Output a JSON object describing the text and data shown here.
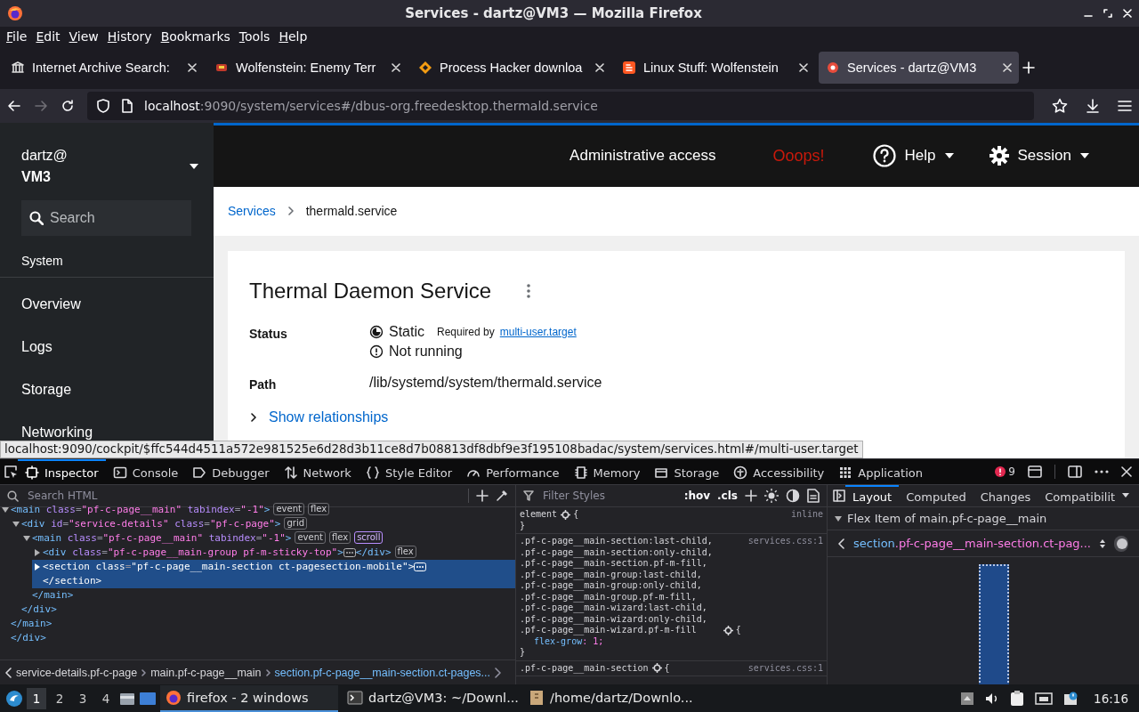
{
  "window": {
    "title": "Services - dartz@VM3 — Mozilla Firefox"
  },
  "menu_bar": [
    "File",
    "Edit",
    "View",
    "History",
    "Bookmarks",
    "Tools",
    "Help"
  ],
  "tabs": [
    {
      "label": "Internet Archive Search:",
      "kind": "archive",
      "selected": false
    },
    {
      "label": "Wolfenstein: Enemy Terr",
      "kind": "game",
      "selected": false
    },
    {
      "label": "Process Hacker downloa",
      "kind": "diamond",
      "selected": false
    },
    {
      "label": "Linux Stuff: Wolfenstein",
      "kind": "blog",
      "selected": false
    },
    {
      "label": "Services - dartz@VM3",
      "kind": "cockpit",
      "selected": true
    }
  ],
  "address_bar": {
    "host": "localhost",
    "rest": ":9090/system/services#/dbus-org.freedesktop.thermald.service"
  },
  "cockpit": {
    "sidebar": {
      "user": "dartz@",
      "host": "VM3",
      "search": {
        "placeholder": "Search"
      },
      "section": "System",
      "items": [
        {
          "label": "Overview",
          "selected": false
        },
        {
          "label": "Logs",
          "selected": false
        },
        {
          "label": "Storage",
          "selected": false
        },
        {
          "label": "Networking",
          "selected": false
        }
      ]
    },
    "header": {
      "admin": "Administrative access",
      "alert": "Ooops!",
      "help": "Help",
      "session": "Session"
    },
    "breadcrumb": [
      {
        "label": "Services",
        "kind": "link"
      },
      {
        "label": "thermald.service",
        "kind": "current"
      }
    ],
    "service": {
      "title": "Thermal Daemon Service",
      "fields": [
        {
          "label": "Status",
          "values": [
            {
              "kind": "static",
              "text": "Static",
              "note": "Required by",
              "link": "multi-user.target"
            },
            {
              "kind": "stopped",
              "text": "Not running"
            }
          ]
        },
        {
          "label": "Path",
          "values": [
            {
              "kind": "plain",
              "text": "/lib/systemd/system/thermald.service"
            }
          ]
        }
      ],
      "relationships": {
        "label": "Show relationships",
        "expanded": false
      }
    }
  },
  "status_tooltip": "localhost:9090/cockpit/$ffc544d4511a572e981525e6d28d3b11ce8d7b08813df8dbf9e3f195108badac/system/services.html#/multi-user.target",
  "devtools": {
    "tabs": [
      {
        "label": "Inspector",
        "kind": "inspector",
        "selected": true
      },
      {
        "label": "Console",
        "kind": "console",
        "selected": false
      },
      {
        "label": "Debugger",
        "kind": "debugger",
        "selected": false
      },
      {
        "label": "Network",
        "kind": "network",
        "selected": false
      },
      {
        "label": "Style Editor",
        "kind": "style",
        "selected": false
      },
      {
        "label": "Performance",
        "kind": "performance",
        "selected": false
      },
      {
        "label": "Memory",
        "kind": "memory",
        "selected": false
      },
      {
        "label": "Storage",
        "kind": "storage",
        "selected": false
      },
      {
        "label": "Accessibility",
        "kind": "accessibility",
        "selected": false
      },
      {
        "label": "Application",
        "kind": "application",
        "selected": false
      }
    ],
    "error_count": "9",
    "markup": {
      "search": {
        "placeholder": "Search HTML"
      },
      "tree": [
        {
          "close": "</div>",
          "children": [
            {
              "open": "<main class=\"pf-c-page__main\" tabindex=\"-1\">",
              "badges": [
                "event",
                "flex"
              ],
              "expanded": true,
              "selected": false,
              "close": "</main>",
              "children": [
                {
                  "open": "<div id=\"service-details\" class=\"pf-c-page\">",
                  "badges": [
                    "grid"
                  ],
                  "expanded": true,
                  "selected": false,
                  "close": "</div>",
                  "children": [
                    {
                      "open": "<main class=\"pf-c-page__main\" tabindex=\"-1\">",
                      "badges": [
                        "event",
                        "flex",
                        "scroll"
                      ],
                      "expanded": true,
                      "selected": false,
                      "close": "</main>",
                      "children": [
                        {
                          "open": "<div class=\"pf-c-page__main-group pf-m-sticky-top\">",
                          "close": "</div>",
                          "badges": [
                            "flex"
                          ],
                          "expanded": false,
                          "selected": false
                        },
                        {
                          "open": "<section class=\"pf-c-page__main-section ct-pagesection-mobile\">",
                          "close": "</section>",
                          "expanded": false,
                          "selected": true
                        }
                      ]
                    }
                  ]
                }
              ]
            }
          ]
        }
      ],
      "breadcrumbs": [
        {
          "label": "service-details.pf-c-page",
          "selected": false
        },
        {
          "label": "main.pf-c-page__main",
          "selected": false
        },
        {
          "label": "section.pf-c-page__main-section.ct-pages...",
          "selected": true
        }
      ]
    },
    "styles": {
      "filter": {
        "placeholder": "Filter Styles"
      },
      "hov": ":hov",
      "cls": ".cls",
      "rules": [
        {
          "selector": "element",
          "open": "{",
          "source": "inline",
          "close": "}"
        },
        {
          "selector": ".pf-c-page__main-section:last-child, .pf-c-page__main-section:only-child, .pf-c-page__main-section.pf-m-fill, .pf-c-page__main-group:last-child, .pf-c-page__main-group:only-child, .pf-c-page__main-group.pf-m-fill, .pf-c-page__main-wizard:last-child, .pf-c-page__main-wizard:only-child, .pf-c-page__main-wizard.pf-m-fill",
          "open": "{",
          "source": "services.css:1",
          "declarations": [
            "flex-grow: 1;"
          ],
          "close": "}"
        },
        {
          "selector": ".pf-c-page__main-section",
          "open": "{",
          "source": "services.css:1"
        }
      ]
    },
    "layout": {
      "tabs": [
        {
          "label": "Layout",
          "selected": true
        },
        {
          "label": "Computed",
          "selected": false
        },
        {
          "label": "Changes",
          "selected": false
        },
        {
          "label": "Compatibilit",
          "selected": false
        }
      ],
      "flex_heading": "Flex Item of main.pf-c-page__main",
      "item": {
        "tag": "section",
        "classes": ".pf-c-page__main-section.ct-pag...",
        "highlight_on": false
      }
    }
  },
  "taskbar": {
    "workspaces": [
      {
        "label": "1",
        "selected": true
      },
      {
        "label": "2",
        "selected": false
      },
      {
        "label": "3",
        "selected": false
      },
      {
        "label": "4",
        "selected": false
      }
    ],
    "tasks": [
      {
        "label": "firefox - 2 windows",
        "kind": "firefox",
        "selected": true
      },
      {
        "label": "dartz@VM3: ~/Downl...",
        "kind": "terminal",
        "selected": false
      },
      {
        "label": "/home/dartz/Downlo...",
        "kind": "folder",
        "selected": false
      }
    ],
    "clock": "16:16"
  }
}
